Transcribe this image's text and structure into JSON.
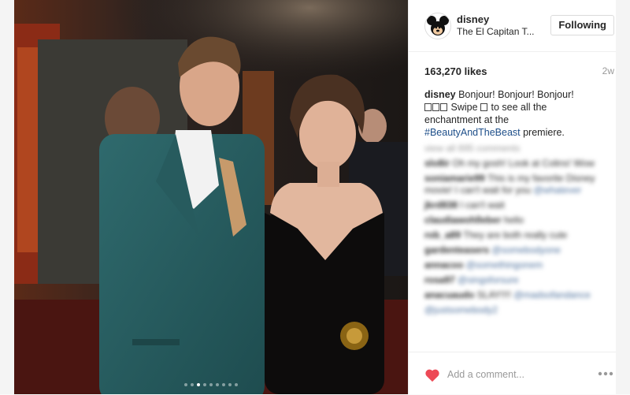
{
  "post": {
    "username": "disney",
    "location": "The El Capitan T...",
    "follow_label": "Following",
    "likes": "163,270 likes",
    "age": "2w",
    "caption": {
      "username": "disney",
      "text_1": "Bonjour! Bonjour! Bonjour!",
      "text_2": "Swipe",
      "text_3": "to see all the enchantment at the",
      "hashtag": "#BeautyAndTheBeast",
      "text_4": "premiere."
    },
    "comment_placeholder": "Add a comment...",
    "carousel": {
      "count": 9,
      "active_index": 2
    }
  },
  "comments": [
    {
      "user": "",
      "text": "view all 895 comments",
      "gray": true
    },
    {
      "user": "slo8ir",
      "text": "Oh my gosh! Look at Colins! Wow"
    },
    {
      "user": "soniamarie99",
      "text": "This is my favorite Disney movie! I can't wait for you",
      "link": "@whatever"
    },
    {
      "user": "jkrd838",
      "text": "I can't wait"
    },
    {
      "user": "claudiawohlleber",
      "text": "hello"
    },
    {
      "user": "rob_a89",
      "text": "They are both really cute"
    },
    {
      "user": "gardenteasers",
      "text": "",
      "link": "@somebodyone"
    },
    {
      "user": "annacoo",
      "text": "",
      "link": "@somethingonem"
    },
    {
      "user": "rosa97",
      "text": "",
      "link": "@singsforsure"
    },
    {
      "user": "anacuaudo",
      "text": "SLAY!!!!",
      "link": "@madsofandance"
    },
    {
      "user": "",
      "text": "",
      "link": "@justsomebody2"
    }
  ],
  "colors": {
    "heart": "#ed4956",
    "link": "#1d4e89"
  },
  "icons": {
    "avatar": "mickey-avatar",
    "heart": "heart-icon",
    "more": "more-options-icon"
  }
}
